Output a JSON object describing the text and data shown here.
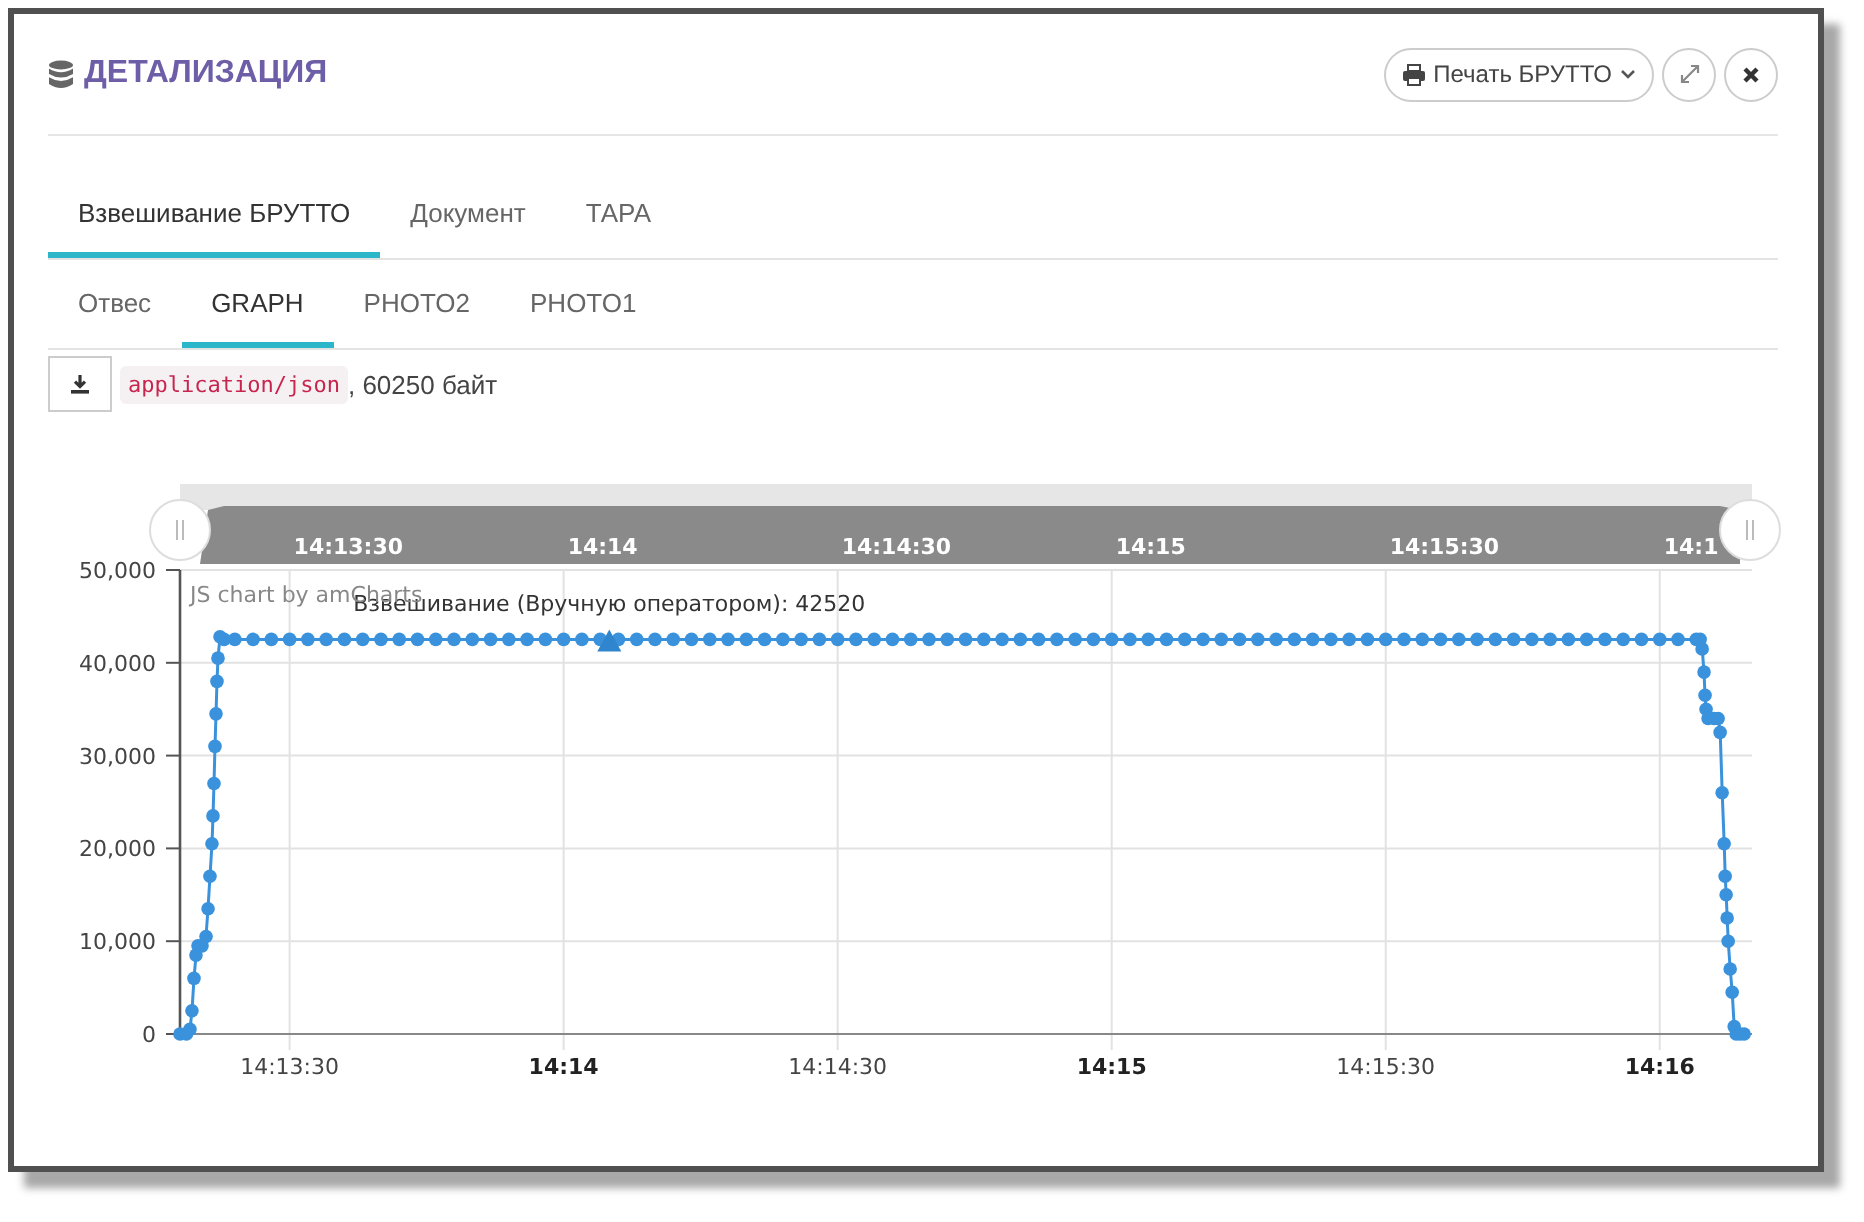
{
  "dialog": {
    "title": "ДЕТАЛИЗАЦИЯ",
    "print_button": {
      "label": "Печать БРУТТО"
    }
  },
  "tabs": [
    {
      "label": "Взвешивание БРУТТО",
      "selected": true
    },
    {
      "label": "Документ",
      "selected": false
    },
    {
      "label": "ТАРА",
      "selected": false
    }
  ],
  "subtabs": [
    {
      "label": "Отвес",
      "selected": false
    },
    {
      "label": "GRAPH",
      "selected": true
    },
    {
      "label": "PHOTO2",
      "selected": false
    },
    {
      "label": "PHOTO1",
      "selected": false
    }
  ],
  "file": {
    "mime": "application/json",
    "size": ", 60250 байт"
  },
  "graph": {
    "credit": "JS chart by amCharts",
    "navigator_labels": [
      "14:13:30",
      "14:14",
      "14:14:30",
      "14:15",
      "14:15:30",
      "14:1"
    ],
    "chart_data": {
      "type": "line",
      "grid": true,
      "xlim": [
        51198,
        51370.1
      ],
      "ylim": [
        0,
        50000
      ],
      "xticks": [
        {
          "value": 51210,
          "label": "14:13:30"
        },
        {
          "value": 51240,
          "label": "14:14"
        },
        {
          "value": 51270,
          "label": "14:14:30"
        },
        {
          "value": 51300,
          "label": "14:15"
        },
        {
          "value": 51330,
          "label": "14:15:30"
        },
        {
          "value": 51360,
          "label": "14:16"
        }
      ],
      "yticks": [
        {
          "value": 0,
          "label": "0"
        },
        {
          "value": 10000,
          "label": "10,000"
        },
        {
          "value": 20000,
          "label": "20,000"
        },
        {
          "value": 30000,
          "label": "30,000"
        },
        {
          "value": 40000,
          "label": "40,000"
        },
        {
          "value": 50000,
          "label": "50,000"
        }
      ],
      "x": [
        51198,
        51198.7,
        51199.09,
        51199.31,
        51199.53,
        51199.75,
        51199.97,
        51200.41,
        51200.85,
        51201.07,
        51201.28,
        51201.5,
        51201.61,
        51201.72,
        51201.83,
        51201.94,
        51202.05,
        51202.16,
        51202.38,
        51202.82,
        51204,
        51206,
        51208,
        51210,
        51212,
        51214,
        51216,
        51218,
        51220,
        51222,
        51224,
        51226,
        51228,
        51230,
        51232,
        51234,
        51236,
        51238,
        51240,
        51242,
        51244,
        51246,
        51248,
        51250,
        51252,
        51254,
        51256,
        51258,
        51260,
        51262,
        51264,
        51266,
        51268,
        51270,
        51272,
        51274,
        51276,
        51278,
        51280,
        51282,
        51284,
        51286,
        51288,
        51290,
        51292,
        51294,
        51296,
        51298,
        51300,
        51302,
        51304,
        51306,
        51308,
        51310,
        51312,
        51314,
        51316,
        51318,
        51320,
        51322,
        51324,
        51326,
        51328,
        51330,
        51332,
        51334,
        51336,
        51338,
        51340,
        51342,
        51344,
        51346,
        51348,
        51350,
        51352,
        51354,
        51356,
        51358,
        51360,
        51362,
        51364,
        51364.42,
        51364.64,
        51364.85,
        51364.96,
        51365.07,
        51365.29,
        51365.95,
        51366.39,
        51366.61,
        51366.83,
        51367.05,
        51367.16,
        51367.27,
        51367.38,
        51367.49,
        51367.71,
        51367.93,
        51368.15,
        51368.37,
        51368.8,
        51369.24
      ],
      "series": [
        {
          "color": "#3a92dc",
          "marker": "circle",
          "values": [
            0,
            0,
            500,
            2500,
            6000,
            8500,
            9500,
            9500,
            10500,
            13500,
            17000,
            20500,
            23500,
            27000,
            31000,
            34500,
            38000,
            40500,
            42800,
            42520,
            42520,
            42520,
            42520,
            42520,
            42520,
            42520,
            42520,
            42520,
            42520,
            42520,
            42520,
            42520,
            42520,
            42520,
            42520,
            42520,
            42520,
            42520,
            42520,
            42520,
            42520,
            42520,
            42520,
            42520,
            42520,
            42520,
            42520,
            42520,
            42520,
            42520,
            42520,
            42520,
            42520,
            42520,
            42520,
            42520,
            42520,
            42520,
            42520,
            42520,
            42520,
            42520,
            42520,
            42520,
            42520,
            42520,
            42520,
            42520,
            42520,
            42520,
            42520,
            42520,
            42520,
            42520,
            42520,
            42520,
            42520,
            42520,
            42520,
            42520,
            42520,
            42520,
            42520,
            42520,
            42520,
            42520,
            42520,
            42520,
            42520,
            42520,
            42520,
            42520,
            42520,
            42520,
            42520,
            42520,
            42520,
            42520,
            42520,
            42520,
            42520,
            42520,
            41500,
            39000,
            36500,
            35000,
            34000,
            34000,
            34000,
            32500,
            26000,
            20500,
            17000,
            15000,
            12500,
            10000,
            7000,
            4500,
            800,
            0,
            0,
            0
          ]
        }
      ],
      "annotations": [
        {
          "x": 51245,
          "y": 42520,
          "text": "Взвешивание (Вручную оператором): 42520"
        }
      ]
    }
  }
}
